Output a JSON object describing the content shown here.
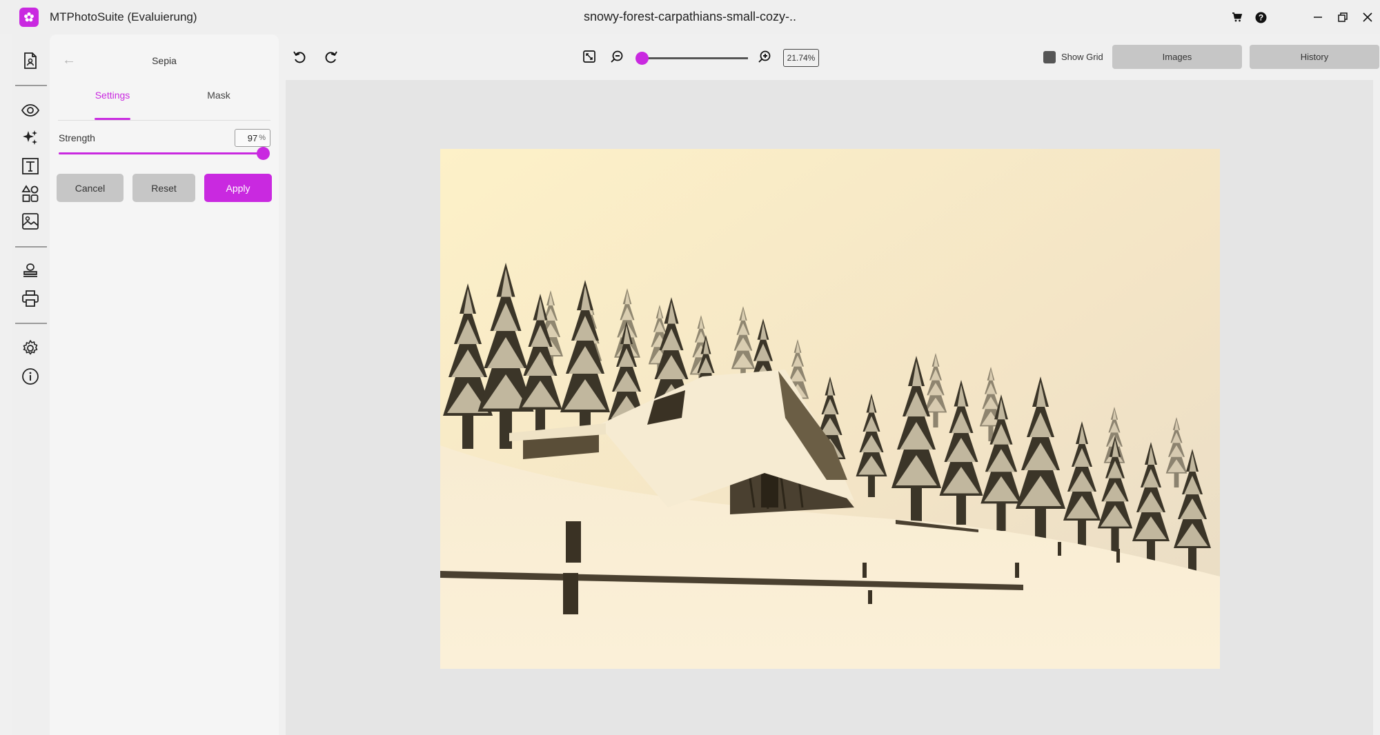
{
  "app": {
    "title": "MTPhotoSuite (Evaluierung)",
    "document_title": "snowy-forest-carpathians-small-cozy-..",
    "accent_color": "#c929e0"
  },
  "titlebar": {
    "icons": [
      "cart-icon",
      "help-icon",
      "minimize-icon",
      "restore-icon",
      "close-icon"
    ],
    "cart": "🛒",
    "help": "?",
    "minimize": "─",
    "restore": "❐",
    "close": "✕"
  },
  "rail": {
    "items": [
      {
        "name": "open-file-icon"
      },
      {
        "name": "view-icon"
      },
      {
        "name": "effects-icon"
      },
      {
        "name": "text-icon"
      },
      {
        "name": "shapes-icon"
      },
      {
        "name": "image-icon"
      },
      {
        "name": "stamp-icon"
      },
      {
        "name": "print-icon"
      },
      {
        "name": "settings-icon"
      },
      {
        "name": "info-icon"
      }
    ]
  },
  "panel": {
    "back": "←",
    "title": "Sepia",
    "tabs": [
      {
        "label": "Settings",
        "active": true
      },
      {
        "label": "Mask",
        "active": false
      }
    ],
    "strength": {
      "label": "Strength",
      "value": "97",
      "unit": "%",
      "fraction": 0.97
    },
    "buttons": {
      "cancel": "Cancel",
      "reset": "Reset",
      "apply": "Apply"
    }
  },
  "toolbar": {
    "undo": "undo-icon",
    "redo": "redo-icon",
    "fit": "fit-screen-icon",
    "zoom_out": "zoom-out-icon",
    "zoom_in": "zoom-in-icon",
    "zoom_value": "21.74%",
    "zoom_fraction": 0.0,
    "show_grid_label": "Show Grid",
    "images_label": "Images",
    "history_label": "History"
  }
}
